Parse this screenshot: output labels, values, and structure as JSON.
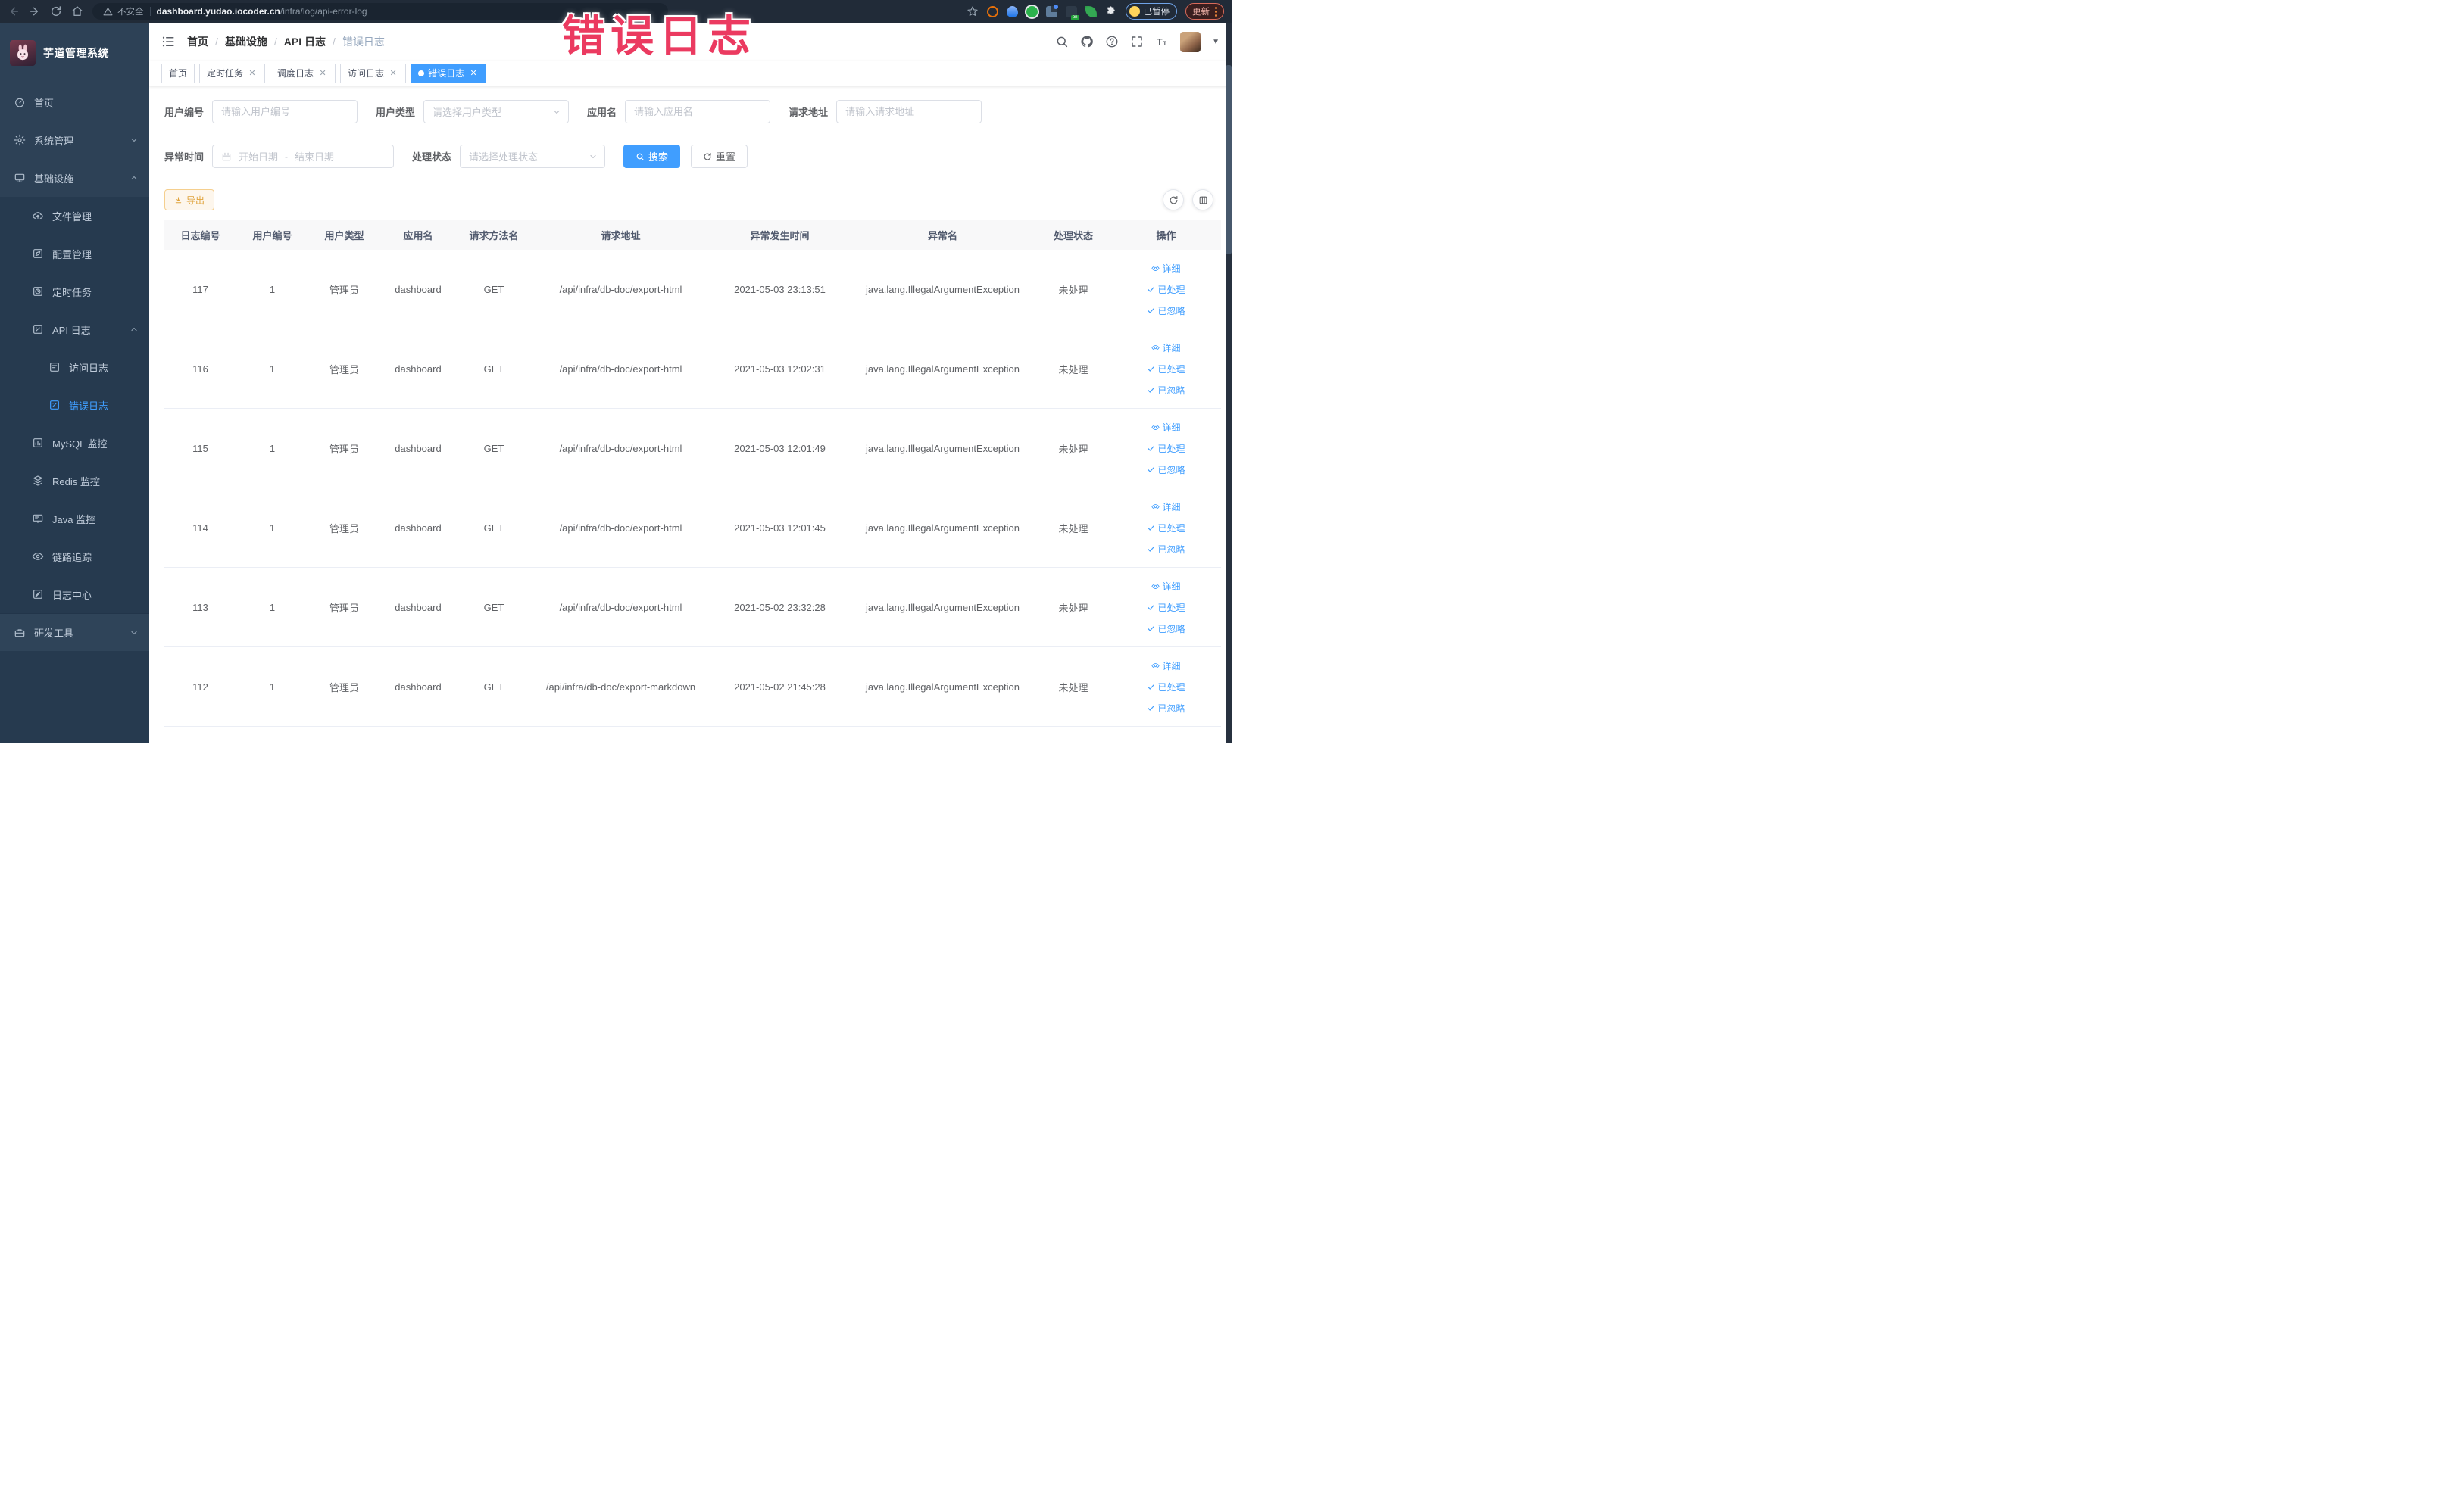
{
  "browser": {
    "security_label": "不安全",
    "url_host": "dashboard.yudao.iocoder.cn",
    "url_path": "/infra/log/api-error-log",
    "paused_label": "已暂停",
    "update_label": "更新"
  },
  "overlay_title": "错误日志",
  "sidebar": {
    "app_title": "芋道管理系统",
    "items": [
      {
        "label": "首页"
      },
      {
        "label": "系统管理"
      },
      {
        "label": "基础设施"
      },
      {
        "label": "文件管理"
      },
      {
        "label": "配置管理"
      },
      {
        "label": "定时任务"
      },
      {
        "label": "API 日志"
      },
      {
        "label": "访问日志"
      },
      {
        "label": "错误日志"
      },
      {
        "label": "MySQL 监控"
      },
      {
        "label": "Redis 监控"
      },
      {
        "label": "Java 监控"
      },
      {
        "label": "链路追踪"
      },
      {
        "label": "日志中心"
      },
      {
        "label": "研发工具"
      }
    ]
  },
  "navbar": {
    "breadcrumb": [
      "首页",
      "基础设施",
      "API 日志",
      "错误日志"
    ]
  },
  "tags": [
    "首页",
    "定时任务",
    "调度日志",
    "访问日志",
    "错误日志"
  ],
  "filters": {
    "user_no": {
      "label": "用户编号",
      "placeholder": "请输入用户编号"
    },
    "user_type": {
      "label": "用户类型",
      "placeholder": "请选择用户类型"
    },
    "app_name": {
      "label": "应用名",
      "placeholder": "请输入应用名"
    },
    "req_url": {
      "label": "请求地址",
      "placeholder": "请输入请求地址"
    },
    "time": {
      "label": "异常时间",
      "start_placeholder": "开始日期",
      "separator": "-",
      "end_placeholder": "结束日期"
    },
    "status": {
      "label": "处理状态",
      "placeholder": "请选择处理状态"
    },
    "search_label": "搜索",
    "reset_label": "重置"
  },
  "toolbar": {
    "export_label": "导出"
  },
  "table": {
    "columns": [
      "日志编号",
      "用户编号",
      "用户类型",
      "应用名",
      "请求方法名",
      "请求地址",
      "异常发生时间",
      "异常名",
      "处理状态",
      "操作"
    ],
    "actions": [
      "详细",
      "已处理",
      "已忽略"
    ],
    "rows": [
      {
        "log_id": "117",
        "user_id": "1",
        "user_type": "管理员",
        "app_name": "dashboard",
        "method": "GET",
        "url": "/api/infra/db-doc/export-html",
        "time": "2021-05-03 23:13:51",
        "exception": "java.lang.IllegalArgumentException",
        "status": "未处理"
      },
      {
        "log_id": "116",
        "user_id": "1",
        "user_type": "管理员",
        "app_name": "dashboard",
        "method": "GET",
        "url": "/api/infra/db-doc/export-html",
        "time": "2021-05-03 12:02:31",
        "exception": "java.lang.IllegalArgumentException",
        "status": "未处理"
      },
      {
        "log_id": "115",
        "user_id": "1",
        "user_type": "管理员",
        "app_name": "dashboard",
        "method": "GET",
        "url": "/api/infra/db-doc/export-html",
        "time": "2021-05-03 12:01:49",
        "exception": "java.lang.IllegalArgumentException",
        "status": "未处理"
      },
      {
        "log_id": "114",
        "user_id": "1",
        "user_type": "管理员",
        "app_name": "dashboard",
        "method": "GET",
        "url": "/api/infra/db-doc/export-html",
        "time": "2021-05-03 12:01:45",
        "exception": "java.lang.IllegalArgumentException",
        "status": "未处理"
      },
      {
        "log_id": "113",
        "user_id": "1",
        "user_type": "管理员",
        "app_name": "dashboard",
        "method": "GET",
        "url": "/api/infra/db-doc/export-html",
        "time": "2021-05-02 23:32:28",
        "exception": "java.lang.IllegalArgumentException",
        "status": "未处理"
      },
      {
        "log_id": "112",
        "user_id": "1",
        "user_type": "管理员",
        "app_name": "dashboard",
        "method": "GET",
        "url": "/api/infra/db-doc/export-markdown",
        "time": "2021-05-02 21:45:28",
        "exception": "java.lang.IllegalArgumentException",
        "status": "未处理"
      }
    ]
  },
  "colors": {
    "primary": "#409eff",
    "warning_text": "#e6a23c",
    "overlay_red": "#eb3a60",
    "sidebar_bg": "#2d4156"
  }
}
